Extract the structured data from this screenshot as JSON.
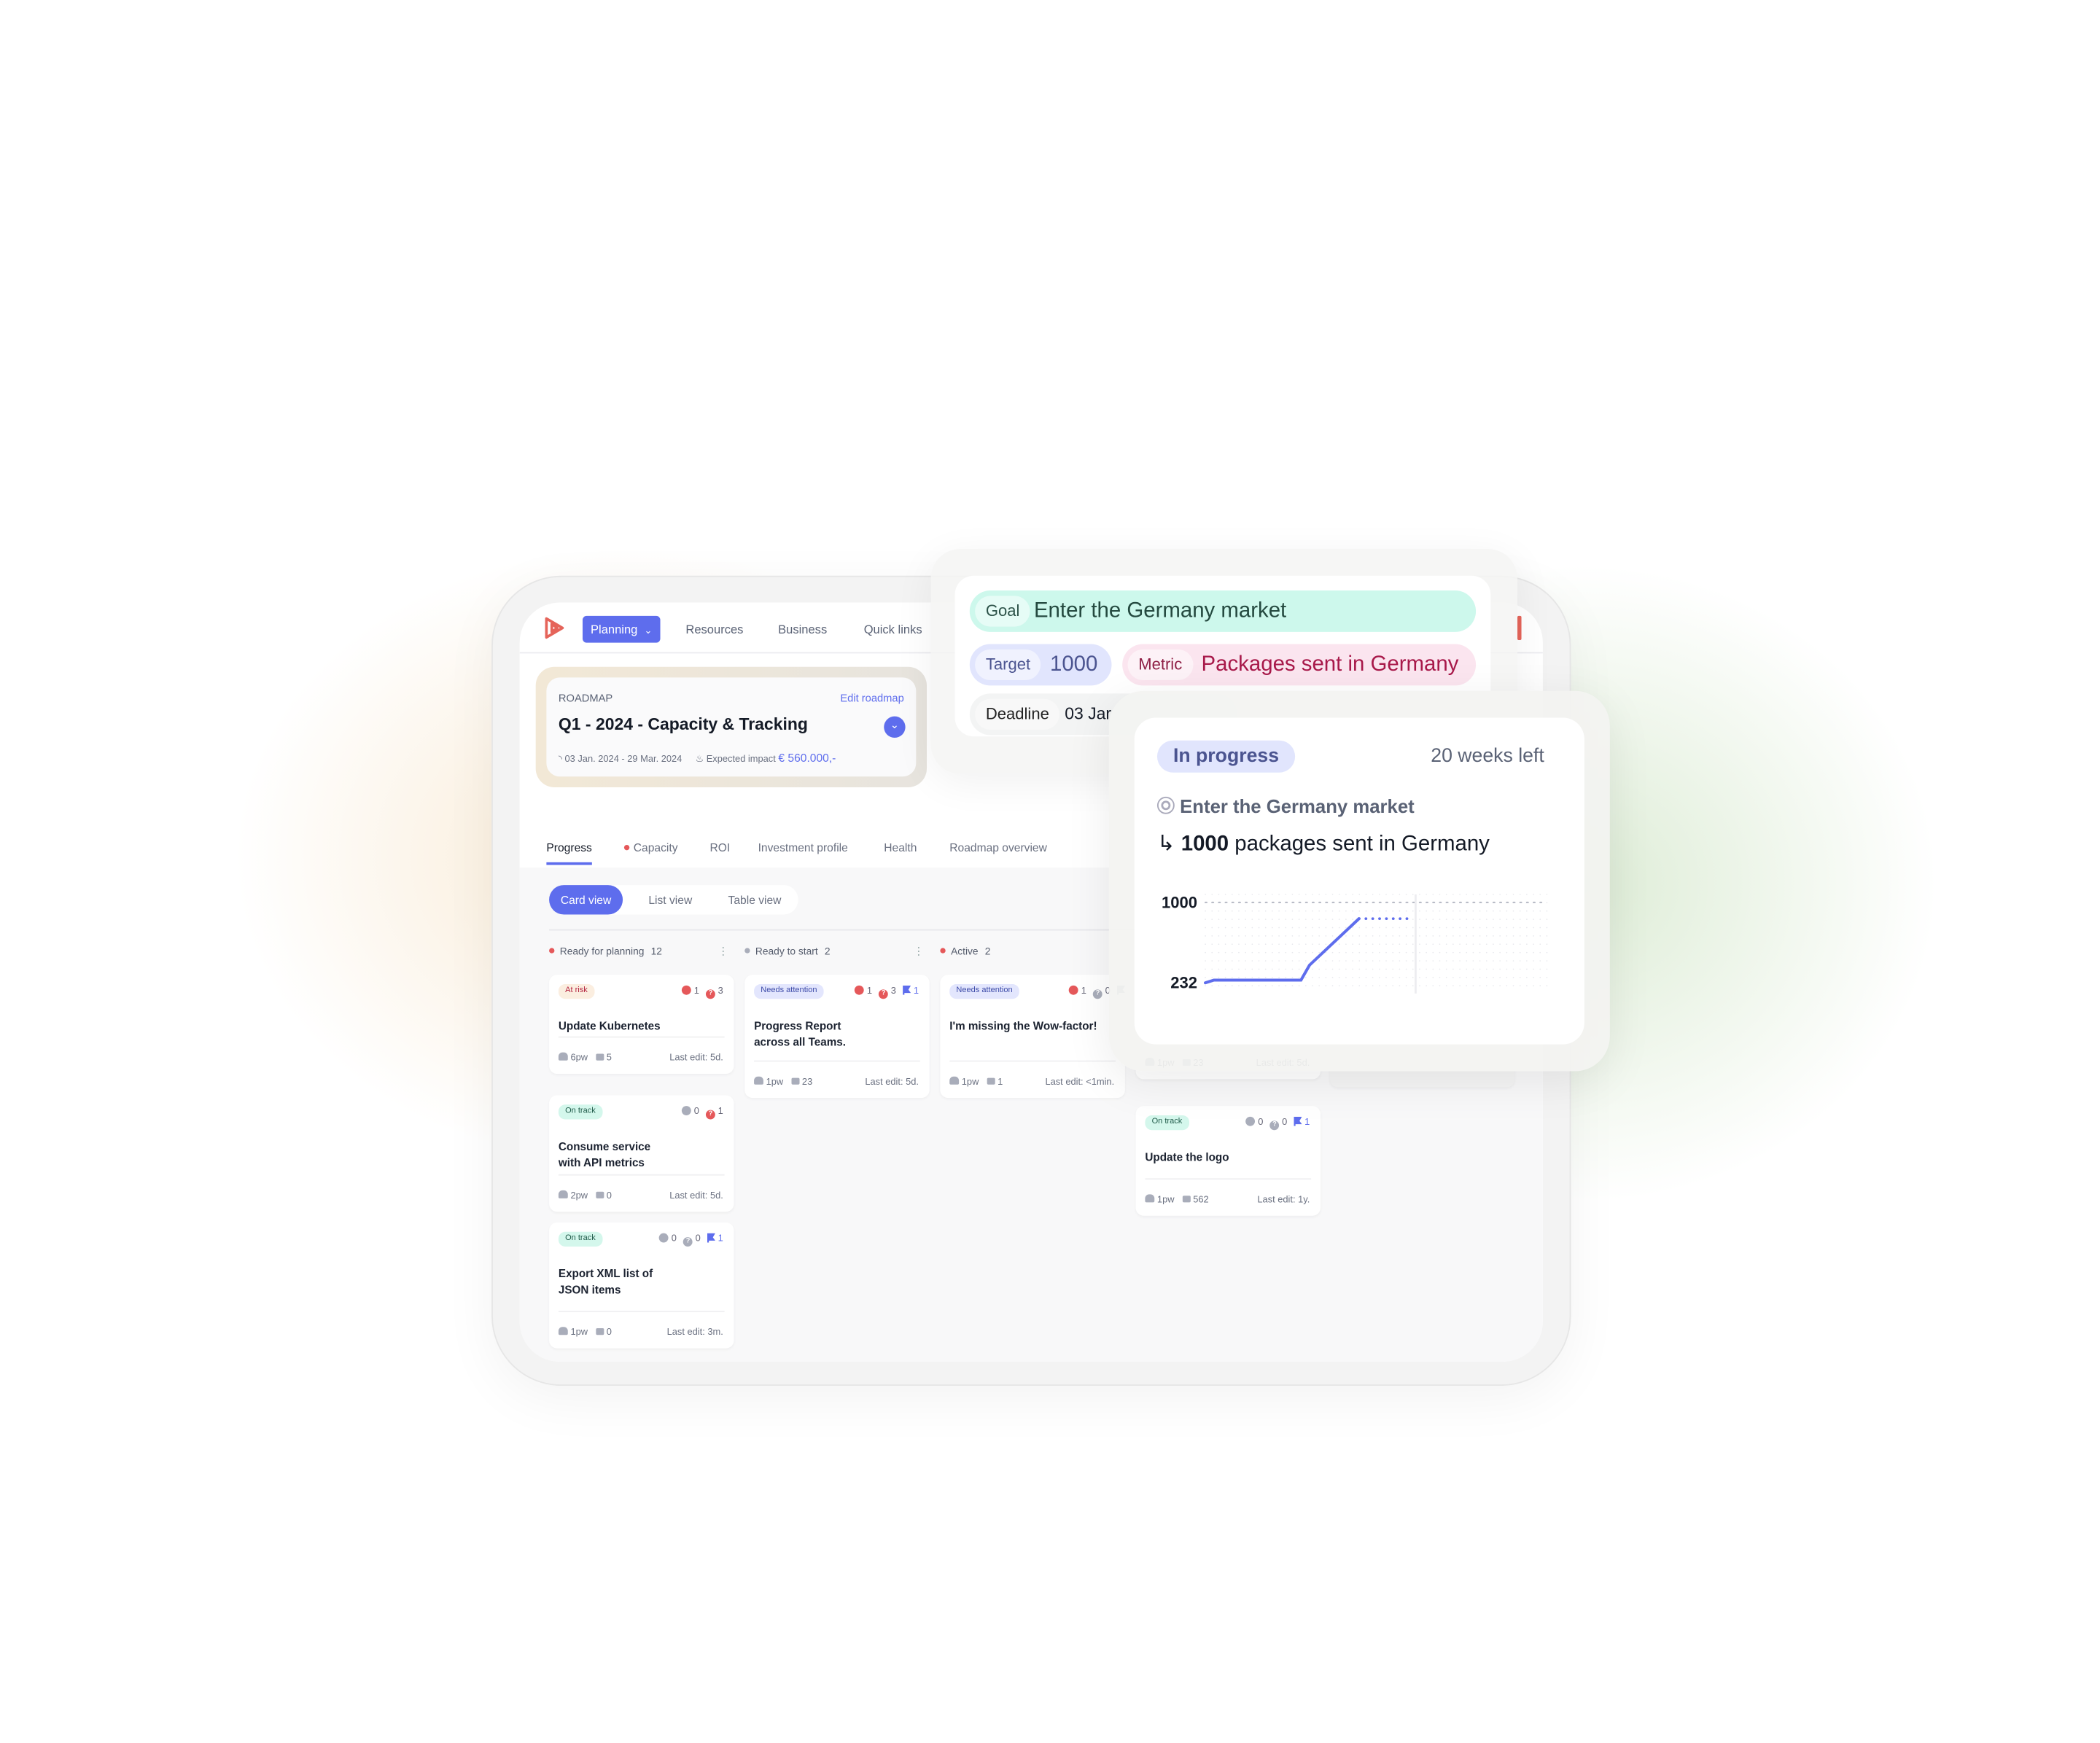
{
  "colors": {
    "accent": "#5e6ded",
    "logo": "#e5645a",
    "at_risk_bg": "#fbeee0",
    "at_risk_fg": "#b4233f",
    "on_track_bg": "#d4f7ec",
    "on_track_fg": "#1f5a49",
    "needs_bg": "#e3e6fd",
    "needs_fg": "#3c4aa8",
    "red": "#e5585a"
  },
  "nav": {
    "logo_icon": "play-hexagon-logo",
    "items": [
      {
        "label": "Planning",
        "active": true
      },
      {
        "label": "Resources"
      },
      {
        "label": "Business"
      },
      {
        "label": "Quick links"
      }
    ]
  },
  "roadmap": {
    "eyebrow": "ROADMAP",
    "edit_label": "Edit roadmap",
    "title": "Q1 - 2024 - Capacity & Tracking",
    "dates": "03 Jan. 2024 - 29 Mar. 2024",
    "impact_label": "Expected impact",
    "impact_value": "€ 560.000,-"
  },
  "tabs": [
    {
      "label": "Progress",
      "active": true
    },
    {
      "label": "Capacity",
      "dot": true
    },
    {
      "label": "ROI"
    },
    {
      "label": "Investment profile"
    },
    {
      "label": "Health"
    },
    {
      "label": "Roadmap overview"
    }
  ],
  "views": [
    {
      "label": "Card view",
      "active": true
    },
    {
      "label": "List view"
    },
    {
      "label": "Table view"
    }
  ],
  "columns": [
    {
      "label": "Ready for planning",
      "count": "12",
      "dot": "#e5585a",
      "cards": [
        {
          "status": "At risk",
          "kind": "risk",
          "blockers": "1",
          "questions": "3",
          "title": "Update Kubernetes",
          "people": "6pw",
          "comments": "5",
          "last_edit": "Last edit: 5d."
        },
        {
          "status": "On track",
          "kind": "track",
          "blockers": "0",
          "questions": "1",
          "title": "Consume service with API metrics",
          "people": "2pw",
          "comments": "0",
          "last_edit": "Last edit: 5d."
        },
        {
          "status": "On track",
          "kind": "track",
          "blockers": "0",
          "questions": "0",
          "flags": "1",
          "title": "Export XML list of JSON items",
          "people": "1pw",
          "comments": "0",
          "last_edit": "Last edit: 3m."
        }
      ]
    },
    {
      "label": "Ready to start",
      "count": "2",
      "dot": "#a9adba",
      "cards": [
        {
          "status": "Needs attention",
          "kind": "needs",
          "blockers": "1",
          "questions": "3",
          "flags": "1",
          "title": "Progress Report across all Teams.",
          "people": "1pw",
          "comments": "23",
          "last_edit": "Last edit: 5d."
        }
      ]
    },
    {
      "label": "Active",
      "count": "2",
      "dot": "#e5585a",
      "cards": [
        {
          "status": "Needs attention",
          "kind": "needs",
          "blockers": "1",
          "questions": "0",
          "flags": "0",
          "title": "I'm missing the Wow-factor!",
          "people": "1pw",
          "comments": "1",
          "last_edit": "Last edit: <1min."
        }
      ]
    },
    {
      "cards": [
        {
          "people": "1pw",
          "comments": "23",
          "last_edit": "Last edit: 5d."
        },
        {
          "status": "On track",
          "kind": "track",
          "blockers": "0",
          "questions": "0",
          "flags": "1",
          "title": "Update the logo",
          "people": "1pw",
          "comments": "562",
          "last_edit": "Last edit: 1y."
        }
      ]
    }
  ],
  "goal": {
    "goal_label": "Goal",
    "goal_value": "Enter the Germany market",
    "target_label": "Target",
    "target_value": "1000",
    "metric_label": "Metric",
    "metric_value": "Packages sent in Germany",
    "deadline_label": "Deadline",
    "deadline_value": "03 Jar"
  },
  "progress": {
    "status": "In progress",
    "time_left": "20 weeks left",
    "goal_icon": "target-icon",
    "goal": "Enter the Germany market",
    "arrow_icon": "return-arrow-icon",
    "target_number": "1000",
    "target_text": "packages sent in Germany"
  },
  "chart_data": {
    "type": "line",
    "y_ticks": [
      "1000",
      "232"
    ],
    "ylim": [
      232,
      1000
    ],
    "grid": "dotted",
    "series": [
      {
        "style": "solid",
        "x": [
          0,
          0.25,
          2.8,
          3.05,
          4.5
        ],
        "y": [
          205,
          232,
          232,
          380,
          840
        ]
      },
      {
        "style": "dotted",
        "x": [
          4.5,
          5.95
        ],
        "y": [
          840,
          840
        ]
      }
    ],
    "xlim": [
      0,
      10
    ]
  }
}
